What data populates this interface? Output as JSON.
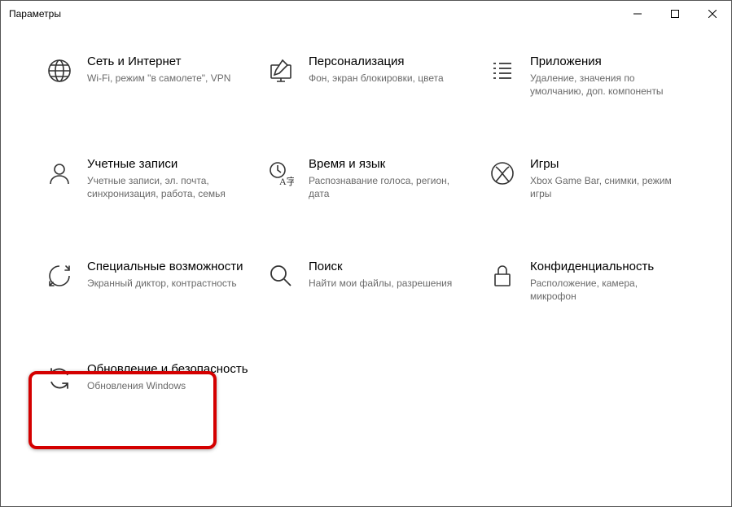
{
  "window": {
    "title": "Параметры"
  },
  "categories": [
    {
      "id": "network",
      "icon": "globe",
      "title": "Сеть и Интернет",
      "desc": "Wi-Fi, режим \"в самолете\", VPN"
    },
    {
      "id": "personal",
      "icon": "pen-monitor",
      "title": "Персонализация",
      "desc": "Фон, экран блокировки, цвета"
    },
    {
      "id": "apps",
      "icon": "apps-list",
      "title": "Приложения",
      "desc": "Удаление, значения по умолчанию, доп. компоненты"
    },
    {
      "id": "accounts",
      "icon": "person",
      "title": "Учетные записи",
      "desc": "Учетные записи, эл. почта, синхронизация, работа, семья"
    },
    {
      "id": "timelang",
      "icon": "time-lang",
      "title": "Время и язык",
      "desc": "Распознавание голоса, регион, дата"
    },
    {
      "id": "gaming",
      "icon": "xbox",
      "title": "Игры",
      "desc": "Xbox Game Bar, снимки, режим игры"
    },
    {
      "id": "ease",
      "icon": "ease",
      "title": "Специальные возможности",
      "desc": "Экранный диктор, контрастность"
    },
    {
      "id": "search",
      "icon": "search",
      "title": "Поиск",
      "desc": "Найти мои файлы, разрешения"
    },
    {
      "id": "privacy",
      "icon": "lock",
      "title": "Конфиденциальность",
      "desc": "Расположение, камера, микрофон"
    },
    {
      "id": "update",
      "icon": "sync",
      "title": "Обновление и безопасность",
      "desc": "Обновления Windows"
    }
  ]
}
